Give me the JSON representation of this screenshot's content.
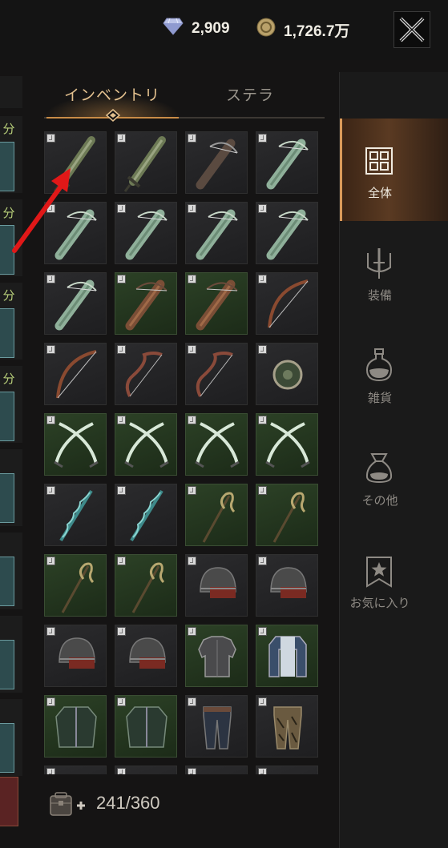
{
  "topbar": {
    "gem_amount": "2,909",
    "gold_amount": "1,726.7万",
    "gem_icon": "diamond-icon",
    "gold_icon": "gold-coin-icon",
    "close_icon": "close-icon"
  },
  "left_panel": {
    "labels": [
      "分",
      "分",
      "分",
      "分"
    ]
  },
  "tabs": [
    {
      "label": "インベントリ",
      "active": true
    },
    {
      "label": "ステラ",
      "active": false
    }
  ],
  "inventory": {
    "capacity": "241/360",
    "rows": [
      [
        {
          "item": "greatsword",
          "bg": "dark"
        },
        {
          "item": "greatsword",
          "bg": "dark"
        },
        {
          "item": "crossbow-dark",
          "bg": "dark"
        },
        {
          "item": "crossbow-green",
          "bg": "dark"
        }
      ],
      [
        {
          "item": "crossbow-green",
          "bg": "dark"
        },
        {
          "item": "crossbow-green",
          "bg": "dark"
        },
        {
          "item": "crossbow-green",
          "bg": "dark"
        },
        {
          "item": "crossbow-green",
          "bg": "dark"
        }
      ],
      [
        {
          "item": "crossbow-green",
          "bg": "dark"
        },
        {
          "item": "crossbow-brown",
          "bg": "green"
        },
        {
          "item": "crossbow-brown",
          "bg": "green"
        },
        {
          "item": "longbow",
          "bg": "dark"
        }
      ],
      [
        {
          "item": "longbow",
          "bg": "dark"
        },
        {
          "item": "recurve-bow",
          "bg": "dark"
        },
        {
          "item": "recurve-bow",
          "bg": "dark"
        },
        {
          "item": "round-shield",
          "bg": "dark"
        }
      ],
      [
        {
          "item": "dual-scimitars",
          "bg": "green"
        },
        {
          "item": "dual-scimitars",
          "bg": "green"
        },
        {
          "item": "dual-scimitars",
          "bg": "green"
        },
        {
          "item": "dual-scimitars",
          "bg": "green"
        }
      ],
      [
        {
          "item": "twisted-staff-teal",
          "bg": "dark"
        },
        {
          "item": "twisted-staff-teal",
          "bg": "dark"
        },
        {
          "item": "serpent-staff",
          "bg": "green"
        },
        {
          "item": "serpent-staff",
          "bg": "green"
        }
      ],
      [
        {
          "item": "serpent-staff",
          "bg": "green"
        },
        {
          "item": "serpent-staff",
          "bg": "green"
        },
        {
          "item": "iron-helmet",
          "bg": "dark"
        },
        {
          "item": "iron-helmet",
          "bg": "dark"
        }
      ],
      [
        {
          "item": "iron-helmet",
          "bg": "dark"
        },
        {
          "item": "iron-helmet",
          "bg": "dark"
        },
        {
          "item": "plate-armor",
          "bg": "green"
        },
        {
          "item": "blue-coat",
          "bg": "green"
        }
      ],
      [
        {
          "item": "green-coat",
          "bg": "green"
        },
        {
          "item": "green-coat",
          "bg": "green"
        },
        {
          "item": "dark-pants",
          "bg": "dark"
        },
        {
          "item": "patterned-pants",
          "bg": "dark"
        }
      ],
      [
        {
          "item": "unknown",
          "bg": "dark"
        },
        {
          "item": "unknown",
          "bg": "dark"
        },
        {
          "item": "unknown",
          "bg": "dark"
        },
        {
          "item": "unknown",
          "bg": "dark"
        }
      ]
    ]
  },
  "categories": [
    {
      "label": "全体",
      "icon": "grid-icon",
      "active": true
    },
    {
      "label": "装備",
      "icon": "sword-icon",
      "active": false
    },
    {
      "label": "雑貨",
      "icon": "potion-icon",
      "active": false
    },
    {
      "label": "その他",
      "icon": "pouch-icon",
      "active": false
    },
    {
      "label": "お気に入り",
      "icon": "bookmark-star-icon",
      "active": false
    }
  ],
  "colors": {
    "accent": "#c98c47",
    "annotation_arrow": "#e01818"
  }
}
